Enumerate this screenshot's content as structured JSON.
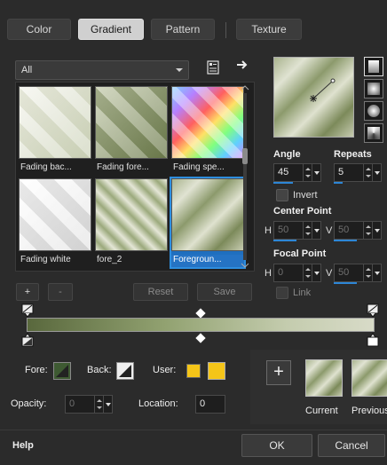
{
  "tabs": [
    {
      "label": "Color",
      "active": false
    },
    {
      "label": "Gradient",
      "active": true
    },
    {
      "label": "Pattern",
      "active": false
    },
    {
      "label": "Texture",
      "active": false
    }
  ],
  "gallery": {
    "filter_value": "All",
    "items": [
      {
        "label": "Fading bac...",
        "selected": false
      },
      {
        "label": "Fading fore...",
        "selected": false
      },
      {
        "label": "Fading spe...",
        "selected": false
      },
      {
        "label": "Fading white",
        "selected": false
      },
      {
        "label": "fore_2",
        "selected": false
      },
      {
        "label": "Foregroun...",
        "selected": true
      }
    ],
    "add_label": "+",
    "remove_label": "-",
    "reset_label": "Reset",
    "save_label": "Save"
  },
  "fields": {
    "angle_label": "Angle",
    "angle_value": "45",
    "repeats_label": "Repeats",
    "repeats_value": "5",
    "invert_label": "Invert",
    "center_point_label": "Center Point",
    "center_h_label": "H",
    "center_h_value": "50",
    "center_v_label": "V",
    "center_v_value": "50",
    "focal_point_label": "Focal Point",
    "focal_h_label": "H",
    "focal_h_value": "0",
    "focal_v_label": "V",
    "focal_v_value": "50",
    "link_label": "Link"
  },
  "stops": {
    "fore_label": "Fore:",
    "back_label": "Back:",
    "user_label": "User:",
    "user_color": "#f5c518",
    "opacity_label": "Opacity:",
    "opacity_value": "0",
    "location_label": "Location:",
    "location_value": "0"
  },
  "preview": {
    "add_label": "+",
    "current_label": "Current",
    "previous_label": "Previous"
  },
  "footer": {
    "help_label": "Help",
    "ok_label": "OK",
    "cancel_label": "Cancel"
  },
  "colors": {
    "accent": "#2e8ede",
    "gradient_dark": "#59683d",
    "gradient_light": "#d8dbc8"
  }
}
